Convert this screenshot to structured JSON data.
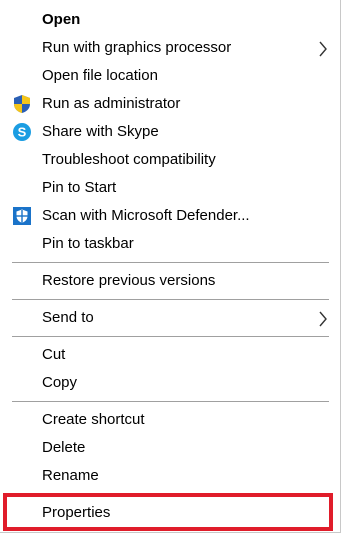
{
  "context_menu": {
    "items": {
      "open": {
        "label": "Open"
      },
      "run_gpu": {
        "label": "Run with graphics processor"
      },
      "open_file_location": {
        "label": "Open file location"
      },
      "run_as_admin": {
        "label": "Run as administrator",
        "icon": "uac-shield-icon"
      },
      "share_skype": {
        "label": "Share with Skype",
        "icon": "skype-icon"
      },
      "troubleshoot": {
        "label": "Troubleshoot compatibility"
      },
      "pin_start": {
        "label": "Pin to Start"
      },
      "scan_defender": {
        "label": "Scan with Microsoft Defender...",
        "icon": "defender-icon"
      },
      "pin_taskbar": {
        "label": "Pin to taskbar"
      },
      "restore_versions": {
        "label": "Restore previous versions"
      },
      "send_to": {
        "label": "Send to"
      },
      "cut": {
        "label": "Cut"
      },
      "copy": {
        "label": "Copy"
      },
      "create_shortcut": {
        "label": "Create shortcut"
      },
      "delete": {
        "label": "Delete"
      },
      "rename": {
        "label": "Rename"
      },
      "properties": {
        "label": "Properties"
      }
    },
    "highlight_color": "#e01c2a"
  }
}
